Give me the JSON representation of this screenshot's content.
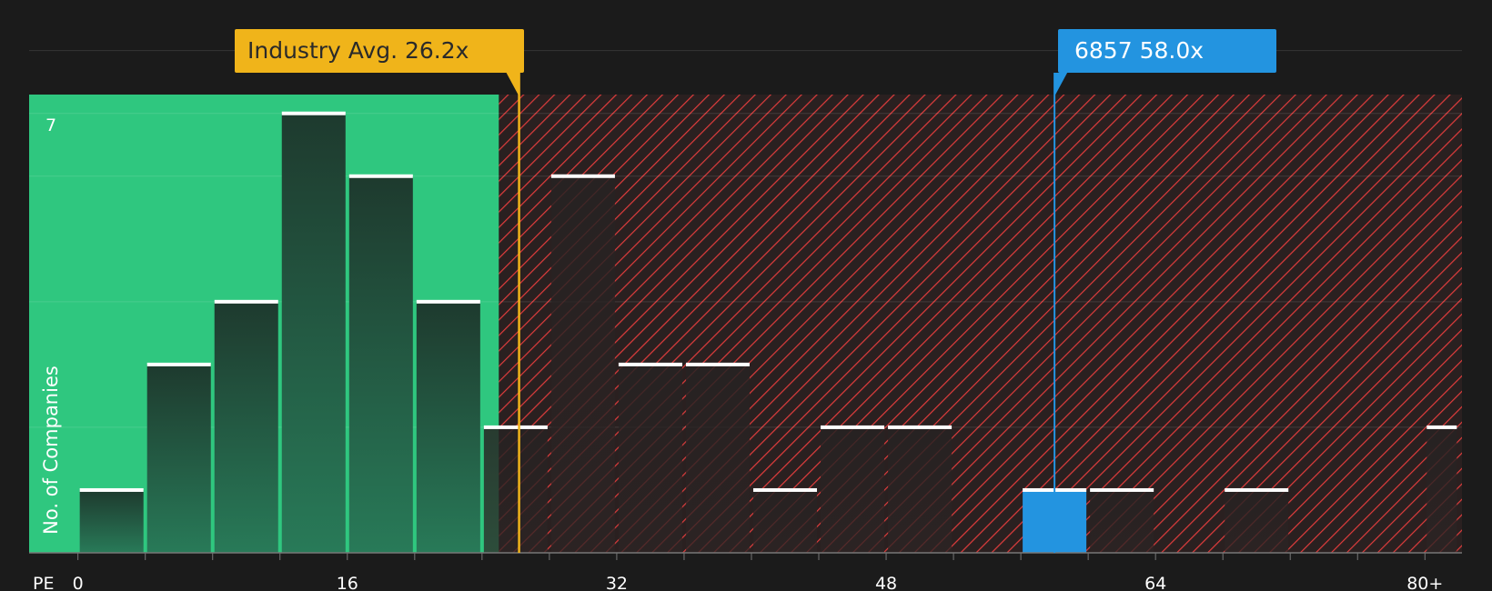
{
  "chart_data": {
    "type": "bar",
    "bins": [
      {
        "x0": 0,
        "x1": 4,
        "count": 1
      },
      {
        "x0": 4,
        "x1": 8,
        "count": 3
      },
      {
        "x0": 8,
        "x1": 12,
        "count": 4
      },
      {
        "x0": 12,
        "x1": 16,
        "count": 7
      },
      {
        "x0": 16,
        "x1": 20,
        "count": 6
      },
      {
        "x0": 20,
        "x1": 24,
        "count": 4
      },
      {
        "x0": 24,
        "x1": 28,
        "count": 2
      },
      {
        "x0": 28,
        "x1": 32,
        "count": 6
      },
      {
        "x0": 32,
        "x1": 36,
        "count": 3
      },
      {
        "x0": 36,
        "x1": 40,
        "count": 3
      },
      {
        "x0": 40,
        "x1": 44,
        "count": 1
      },
      {
        "x0": 44,
        "x1": 48,
        "count": 2
      },
      {
        "x0": 48,
        "x1": 52,
        "count": 2
      },
      {
        "x0": 56,
        "x1": 60,
        "count": 1,
        "highlight": true
      },
      {
        "x0": 60,
        "x1": 64,
        "count": 1
      },
      {
        "x0": 68,
        "x1": 72,
        "count": 1
      },
      {
        "x0": 80,
        "x1": 82,
        "count": 2
      }
    ],
    "xlabel": "PE",
    "ylabel": "No. of Companies",
    "x_ticks": [
      {
        "value": 0,
        "label": "0"
      },
      {
        "value": 16,
        "label": "16"
      },
      {
        "value": 32,
        "label": "32"
      },
      {
        "value": 48,
        "label": "48"
      },
      {
        "value": 64,
        "label": "64"
      },
      {
        "value": 80,
        "label": "80+"
      }
    ],
    "y_tick_label": "7",
    "xlim": [
      -2.9,
      82.2
    ],
    "ylim": [
      0,
      7.3
    ],
    "fair_zone_end": 25,
    "industry_avg": {
      "value": 26.2,
      "label": "Industry Avg. 26.2x"
    },
    "company": {
      "value": 58.0,
      "label": "6857 58.0x"
    },
    "colors": {
      "background": "#1b1b1b",
      "undervalued": "#2fc77f",
      "overvalued_hatch": "#e03c3c",
      "bar_dark": "#1f3b30",
      "industry": "#f0b41a",
      "company": "#2394e0",
      "bar_cap": "#ffffff"
    }
  }
}
